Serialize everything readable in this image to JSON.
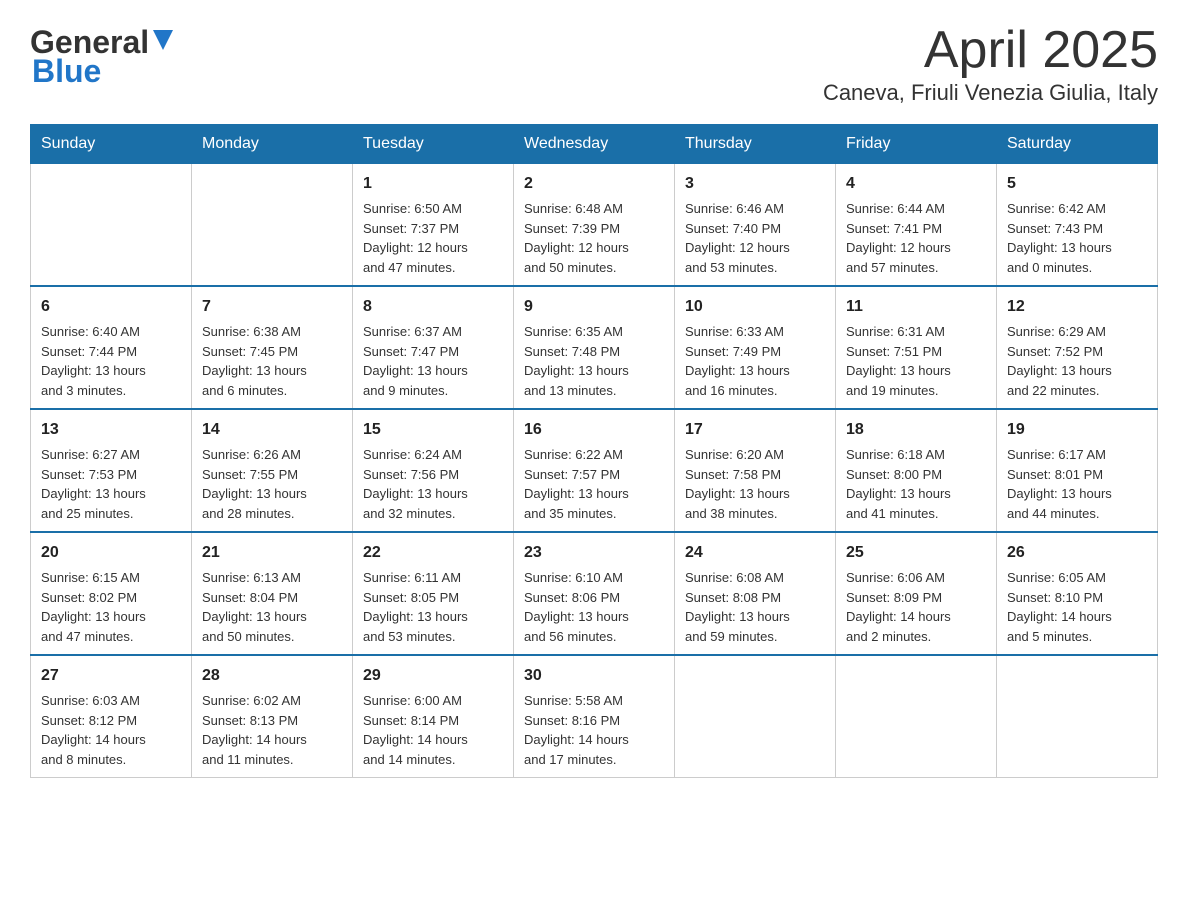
{
  "header": {
    "logo_general": "General",
    "logo_blue": "Blue",
    "month_year": "April 2025",
    "location": "Caneva, Friuli Venezia Giulia, Italy"
  },
  "weekdays": [
    "Sunday",
    "Monday",
    "Tuesday",
    "Wednesday",
    "Thursday",
    "Friday",
    "Saturday"
  ],
  "weeks": [
    [
      {
        "day": "",
        "info": ""
      },
      {
        "day": "",
        "info": ""
      },
      {
        "day": "1",
        "info": "Sunrise: 6:50 AM\nSunset: 7:37 PM\nDaylight: 12 hours\nand 47 minutes."
      },
      {
        "day": "2",
        "info": "Sunrise: 6:48 AM\nSunset: 7:39 PM\nDaylight: 12 hours\nand 50 minutes."
      },
      {
        "day": "3",
        "info": "Sunrise: 6:46 AM\nSunset: 7:40 PM\nDaylight: 12 hours\nand 53 minutes."
      },
      {
        "day": "4",
        "info": "Sunrise: 6:44 AM\nSunset: 7:41 PM\nDaylight: 12 hours\nand 57 minutes."
      },
      {
        "day": "5",
        "info": "Sunrise: 6:42 AM\nSunset: 7:43 PM\nDaylight: 13 hours\nand 0 minutes."
      }
    ],
    [
      {
        "day": "6",
        "info": "Sunrise: 6:40 AM\nSunset: 7:44 PM\nDaylight: 13 hours\nand 3 minutes."
      },
      {
        "day": "7",
        "info": "Sunrise: 6:38 AM\nSunset: 7:45 PM\nDaylight: 13 hours\nand 6 minutes."
      },
      {
        "day": "8",
        "info": "Sunrise: 6:37 AM\nSunset: 7:47 PM\nDaylight: 13 hours\nand 9 minutes."
      },
      {
        "day": "9",
        "info": "Sunrise: 6:35 AM\nSunset: 7:48 PM\nDaylight: 13 hours\nand 13 minutes."
      },
      {
        "day": "10",
        "info": "Sunrise: 6:33 AM\nSunset: 7:49 PM\nDaylight: 13 hours\nand 16 minutes."
      },
      {
        "day": "11",
        "info": "Sunrise: 6:31 AM\nSunset: 7:51 PM\nDaylight: 13 hours\nand 19 minutes."
      },
      {
        "day": "12",
        "info": "Sunrise: 6:29 AM\nSunset: 7:52 PM\nDaylight: 13 hours\nand 22 minutes."
      }
    ],
    [
      {
        "day": "13",
        "info": "Sunrise: 6:27 AM\nSunset: 7:53 PM\nDaylight: 13 hours\nand 25 minutes."
      },
      {
        "day": "14",
        "info": "Sunrise: 6:26 AM\nSunset: 7:55 PM\nDaylight: 13 hours\nand 28 minutes."
      },
      {
        "day": "15",
        "info": "Sunrise: 6:24 AM\nSunset: 7:56 PM\nDaylight: 13 hours\nand 32 minutes."
      },
      {
        "day": "16",
        "info": "Sunrise: 6:22 AM\nSunset: 7:57 PM\nDaylight: 13 hours\nand 35 minutes."
      },
      {
        "day": "17",
        "info": "Sunrise: 6:20 AM\nSunset: 7:58 PM\nDaylight: 13 hours\nand 38 minutes."
      },
      {
        "day": "18",
        "info": "Sunrise: 6:18 AM\nSunset: 8:00 PM\nDaylight: 13 hours\nand 41 minutes."
      },
      {
        "day": "19",
        "info": "Sunrise: 6:17 AM\nSunset: 8:01 PM\nDaylight: 13 hours\nand 44 minutes."
      }
    ],
    [
      {
        "day": "20",
        "info": "Sunrise: 6:15 AM\nSunset: 8:02 PM\nDaylight: 13 hours\nand 47 minutes."
      },
      {
        "day": "21",
        "info": "Sunrise: 6:13 AM\nSunset: 8:04 PM\nDaylight: 13 hours\nand 50 minutes."
      },
      {
        "day": "22",
        "info": "Sunrise: 6:11 AM\nSunset: 8:05 PM\nDaylight: 13 hours\nand 53 minutes."
      },
      {
        "day": "23",
        "info": "Sunrise: 6:10 AM\nSunset: 8:06 PM\nDaylight: 13 hours\nand 56 minutes."
      },
      {
        "day": "24",
        "info": "Sunrise: 6:08 AM\nSunset: 8:08 PM\nDaylight: 13 hours\nand 59 minutes."
      },
      {
        "day": "25",
        "info": "Sunrise: 6:06 AM\nSunset: 8:09 PM\nDaylight: 14 hours\nand 2 minutes."
      },
      {
        "day": "26",
        "info": "Sunrise: 6:05 AM\nSunset: 8:10 PM\nDaylight: 14 hours\nand 5 minutes."
      }
    ],
    [
      {
        "day": "27",
        "info": "Sunrise: 6:03 AM\nSunset: 8:12 PM\nDaylight: 14 hours\nand 8 minutes."
      },
      {
        "day": "28",
        "info": "Sunrise: 6:02 AM\nSunset: 8:13 PM\nDaylight: 14 hours\nand 11 minutes."
      },
      {
        "day": "29",
        "info": "Sunrise: 6:00 AM\nSunset: 8:14 PM\nDaylight: 14 hours\nand 14 minutes."
      },
      {
        "day": "30",
        "info": "Sunrise: 5:58 AM\nSunset: 8:16 PM\nDaylight: 14 hours\nand 17 minutes."
      },
      {
        "day": "",
        "info": ""
      },
      {
        "day": "",
        "info": ""
      },
      {
        "day": "",
        "info": ""
      }
    ]
  ]
}
